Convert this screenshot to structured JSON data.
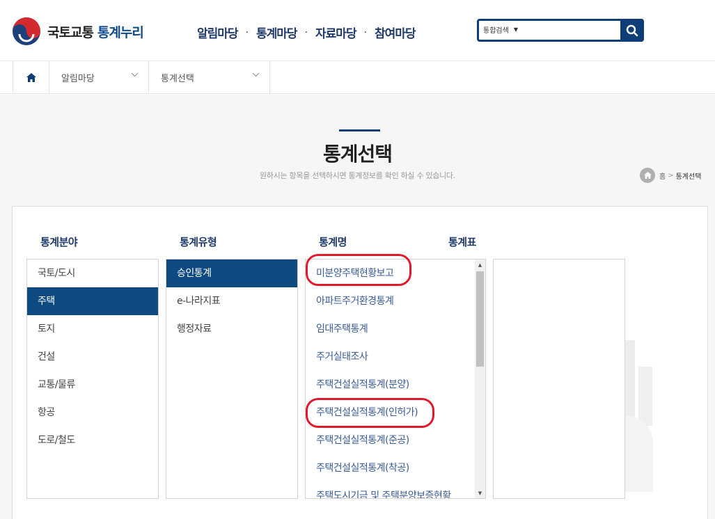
{
  "header": {
    "logo_text": "국토교통",
    "logo_accent": "통계누리",
    "nav": [
      "알림마당",
      "통계마당",
      "자료마당",
      "참여마당"
    ],
    "search": {
      "scope_label": "통합검색",
      "placeholder": "",
      "value": ""
    }
  },
  "breadcrumb_bar": {
    "level1": "알림마당",
    "level2": "통계선택"
  },
  "page": {
    "title": "통계선택",
    "description": "원하시는 항목을 선택하시면 통계정보를 확인 하실 수 있습니다.",
    "location": {
      "home": "홈",
      "separator": ">",
      "current": "통계선택"
    }
  },
  "columns": {
    "field": {
      "header": "통계분야",
      "items": [
        "국토/도시",
        "주택",
        "토지",
        "건설",
        "교통/물류",
        "항공",
        "도로/철도"
      ],
      "selected": "주택"
    },
    "type": {
      "header": "통계유형",
      "items": [
        "승인통계",
        "e-나라지표",
        "행정자료"
      ],
      "selected": "승인통계"
    },
    "name": {
      "header": "통계명",
      "items": [
        "미분양주택현황보고",
        "아파트주거환경통계",
        "임대주택통계",
        "주거실태조사",
        "주택건설실적통계(분양)",
        "주택건설실적통계(인허가)",
        "주택건설실적통계(준공)",
        "주택건설실적통계(착공)",
        "주택도시기금 및 주택분양보증현황"
      ],
      "highlighted": [
        "미분양주택현황보고",
        "주택건설실적통계(인허가)"
      ]
    },
    "table": {
      "header": "통계표",
      "items": []
    }
  },
  "colors": {
    "brand_navy": "#0e3d78",
    "selected_bg": "#0e4a82",
    "highlight_ring": "#e0192b",
    "list_text_blue": "#3a5b98"
  }
}
